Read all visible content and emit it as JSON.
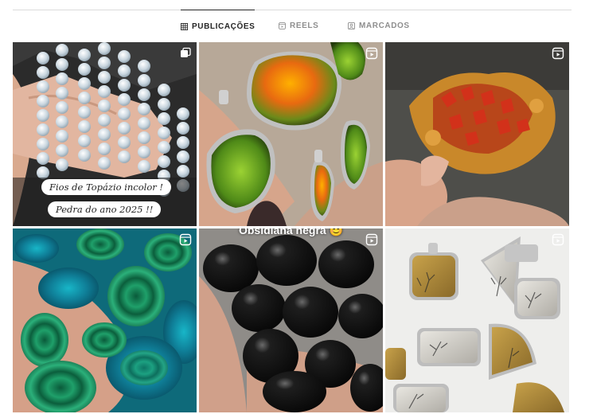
{
  "tabs": [
    {
      "label": "PUBLICAÇÕES",
      "icon": "grid-icon",
      "active": true
    },
    {
      "label": "REELS",
      "icon": "reels-icon",
      "active": false
    },
    {
      "label": "MARCADOS",
      "icon": "tagged-icon",
      "active": false
    }
  ],
  "posts": [
    {
      "subject": "clear topaz bead strands",
      "badge": "carousel-icon",
      "captions": [
        "Fios de Topázio incolor !",
        "Pedra do ano 2025 !!"
      ]
    },
    {
      "subject": "ammolite pendants",
      "badge": "reel-icon"
    },
    {
      "subject": "vanadinite crystal cluster",
      "badge": "reel-icon"
    },
    {
      "subject": "malachite cabochons",
      "badge": "reel-icon"
    },
    {
      "subject": "black obsidian eggs",
      "badge": "reel-icon",
      "overlay_text": "Obsidiana negra 😊"
    },
    {
      "subject": "dendritic agate pendants",
      "badge": "reel-icon"
    }
  ],
  "colors": {
    "accent_text": "#262626",
    "muted_text": "#8e8e8e",
    "divider": "#dbdbdb"
  }
}
